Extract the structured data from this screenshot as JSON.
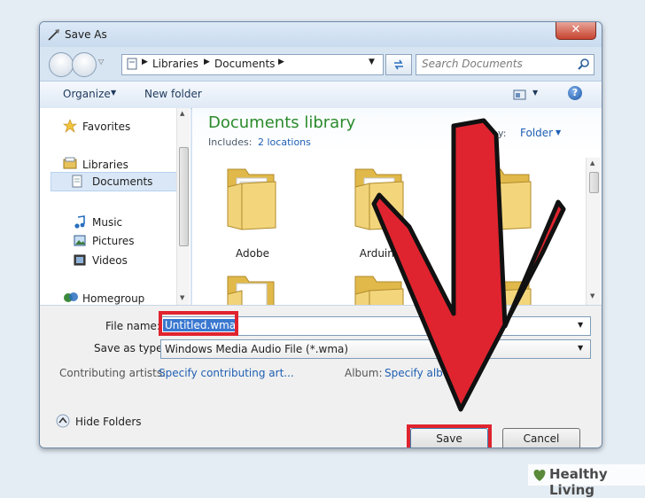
{
  "window": {
    "title": "Save As",
    "close_glyph": "✕"
  },
  "address_bar": {
    "crumbs": [
      "Libraries",
      "Documents"
    ]
  },
  "search": {
    "placeholder": "Search Documents"
  },
  "toolbar": {
    "organize_label": "Organize",
    "new_folder_label": "New folder",
    "help_glyph": "?"
  },
  "sidebar": {
    "favorites": "Favorites",
    "libraries": "Libraries",
    "library_items": [
      "Documents",
      "Music",
      "Pictures",
      "Videos"
    ],
    "homegroup": "Homegroup"
  },
  "library": {
    "title": "Documents library",
    "includes_label": "Includes:",
    "includes_link": "2 locations",
    "arrange_label": "by:",
    "arrange_value": "Folder"
  },
  "folders": [
    {
      "name": "Adobe"
    },
    {
      "name": "Arduino"
    },
    {
      "name": ""
    },
    {
      "name": ""
    },
    {
      "name": ""
    },
    {
      "name": ""
    }
  ],
  "form": {
    "file_name_label": "File name:",
    "file_name_value": "Untitled.wma",
    "type_label": "Save as type:",
    "type_value": "Windows Media Audio File (*.wma)",
    "artists_label": "Contributing artists:",
    "artists_link": "Specify contributing art...",
    "album_label": "Album:",
    "album_link": "Specify albu"
  },
  "footer": {
    "hide_folders_label": "Hide Folders",
    "save_label": "Save",
    "cancel_label": "Cancel"
  },
  "watermark": {
    "brand": "Healthy Living"
  },
  "colors": {
    "highlight_red": "#e0242f",
    "arrow_red": "#e0242f",
    "link_blue": "#1e5fb3",
    "library_green": "#2a8a2a"
  }
}
